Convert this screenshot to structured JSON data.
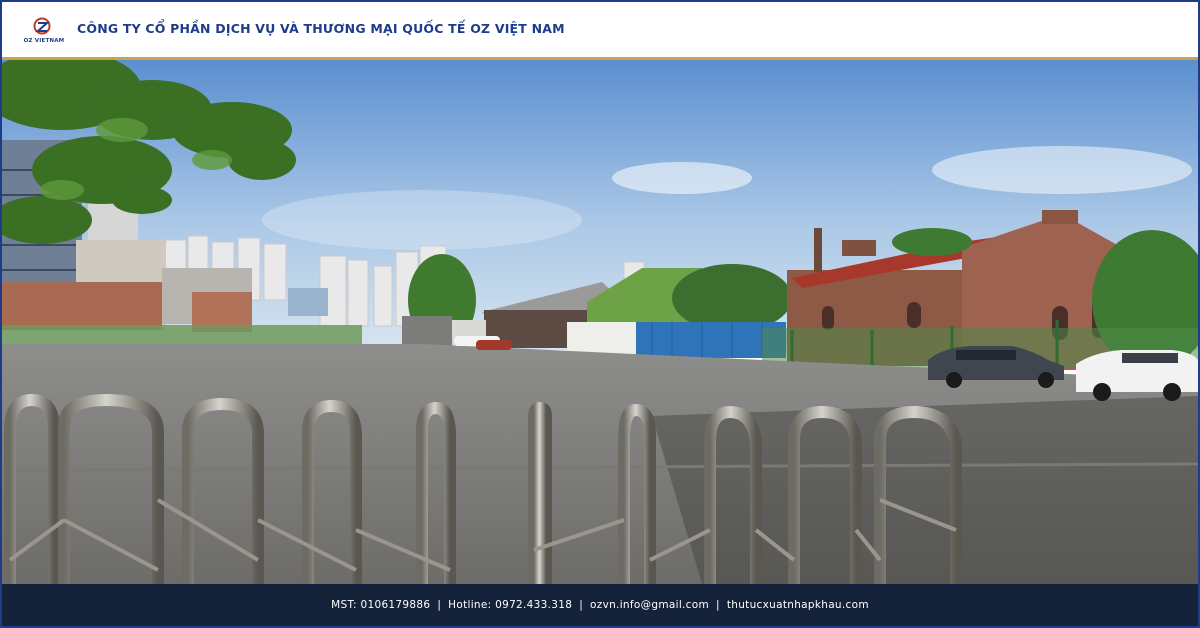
{
  "header": {
    "logo_text": "OZ VIETNAM",
    "company_name": "CÔNG TY CỔ PHẦN DỊCH VỤ VÀ THƯƠNG MẠI QUỐC TẾ OZ VIỆT NAM"
  },
  "footer": {
    "mst": "MST: 0106179886",
    "hotline": "Hotline: 0972.433.318",
    "email": "ozvn.info@gmail.com",
    "website": "thutucxuatnhapkhau.com",
    "separator": "|"
  },
  "colors": {
    "brand_blue": "#1f3c8a",
    "gold_accent": "#c9a24a",
    "footer_bg": "#14223a"
  },
  "photo": {
    "subject": "Parking lot with red brick buildings behind a stainless steel retractable gate"
  }
}
